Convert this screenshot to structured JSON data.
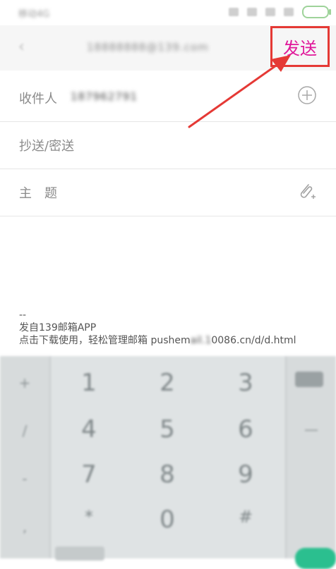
{
  "status_bar": {
    "carrier": "移动4G",
    "battery_color": "#9ed39a"
  },
  "header": {
    "title": "18888888@139.com",
    "send_label": "发送",
    "send_color": "#e0189a",
    "highlight_color": "#e53935"
  },
  "fields": {
    "recipient_label": "收件人",
    "recipient_value": "187962791",
    "cc_label": "抄送/密送",
    "subject_label": "主　题"
  },
  "signature": {
    "separator": "--",
    "line1": "发自139邮箱APP",
    "line2_prefix": "点击下载使用，轻松管理邮箱 pushem",
    "line2_blurred": "ail.1",
    "line2_suffix": "0086.cn/d/d.html"
  },
  "keyboard": {
    "keys": [
      "1",
      "2",
      "3",
      "4",
      "5",
      "6",
      "7",
      "8",
      "9",
      "*",
      "0",
      "#"
    ],
    "side_left": [
      "+",
      "/",
      "-",
      ","
    ],
    "side_right": [
      "⌫",
      "—"
    ]
  },
  "icons": {
    "add": "plus-circle-icon",
    "attach": "paperclip-plus-icon",
    "back": "back-arrow-icon"
  }
}
